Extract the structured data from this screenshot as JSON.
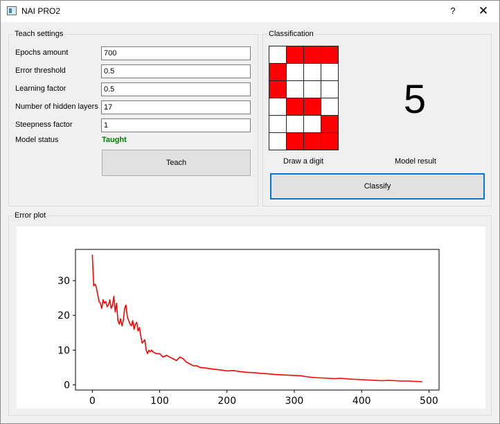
{
  "window": {
    "title": "NAI PRO2",
    "help": "?",
    "close": "✕"
  },
  "teach": {
    "title": "Teach settings",
    "epochs_label": "Epochs amount",
    "epochs_value": "700",
    "error_label": "Error threshold",
    "error_value": "0.5",
    "learning_label": "Learning factor",
    "learning_value": "0.5",
    "hidden_label": "Number of hidden layers",
    "hidden_value": "17",
    "steepness_label": "Steepness factor",
    "steepness_value": "1",
    "status_label": "Model status",
    "status_value": "Taught",
    "status_color": "#008000",
    "teach_button": "Teach"
  },
  "classification": {
    "title": "Classification",
    "grid": [
      [
        0,
        1,
        1,
        1
      ],
      [
        1,
        0,
        0,
        0
      ],
      [
        1,
        0,
        0,
        0
      ],
      [
        0,
        1,
        1,
        0
      ],
      [
        0,
        0,
        0,
        1
      ],
      [
        0,
        1,
        1,
        1
      ]
    ],
    "draw_label": "Draw a digit",
    "result_value": "5",
    "result_label": "Model result",
    "classify_button": "Classify",
    "active_color": "#ff0000"
  },
  "error_plot": {
    "title": "Error plot",
    "x_ticks": [
      "0",
      "100",
      "200",
      "300",
      "400",
      "500"
    ],
    "y_ticks": [
      "0",
      "10",
      "20",
      "30"
    ]
  },
  "chart_data": {
    "type": "line",
    "title": "",
    "xlabel": "",
    "ylabel": "",
    "xlim": [
      -25,
      515
    ],
    "ylim": [
      -1.5,
      39
    ],
    "grid": false,
    "series": [
      {
        "color": "#ff0000",
        "x": [
          0,
          2,
          4,
          6,
          8,
          10,
          12,
          14,
          16,
          18,
          20,
          22,
          24,
          26,
          28,
          30,
          32,
          34,
          36,
          38,
          40,
          42,
          44,
          46,
          48,
          50,
          52,
          54,
          56,
          58,
          60,
          62,
          64,
          66,
          68,
          70,
          72,
          74,
          76,
          78,
          80,
          82,
          84,
          86,
          88,
          90,
          95,
          100,
          105,
          110,
          115,
          120,
          125,
          130,
          135,
          140,
          145,
          150,
          155,
          160,
          170,
          180,
          190,
          200,
          210,
          220,
          230,
          240,
          250,
          260,
          270,
          280,
          290,
          300,
          310,
          320,
          330,
          340,
          350,
          360,
          370,
          380,
          390,
          400,
          410,
          420,
          430,
          440,
          450,
          460,
          470,
          480,
          490
        ],
        "y": [
          37.5,
          28.5,
          29,
          28,
          26,
          24,
          23.5,
          22,
          24.5,
          23.5,
          24,
          22.5,
          23,
          24.5,
          22,
          23,
          25.5,
          21,
          23.5,
          18.5,
          17.5,
          19,
          17,
          18.5,
          22,
          23,
          19.5,
          18.5,
          17.5,
          17,
          18.5,
          16,
          17.5,
          18,
          15.5,
          16.5,
          14,
          12,
          12.5,
          13,
          10,
          9,
          10,
          9.5,
          10,
          9.5,
          9,
          9,
          8,
          8.5,
          8,
          7.5,
          7,
          8,
          7.5,
          6.5,
          6,
          5.5,
          5.5,
          5,
          4.8,
          4.5,
          4.3,
          4,
          4.1,
          3.8,
          3.6,
          3.5,
          3.3,
          3.2,
          3,
          2.9,
          2.8,
          2.7,
          2.6,
          2.3,
          2.1,
          2,
          1.9,
          1.8,
          1.9,
          1.7,
          1.6,
          1.5,
          1.4,
          1.3,
          1.2,
          1.3,
          1.2,
          1.1,
          1.1,
          1,
          0.9
        ]
      }
    ]
  }
}
